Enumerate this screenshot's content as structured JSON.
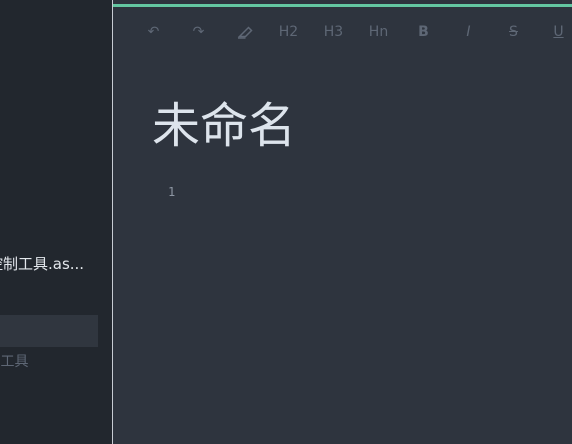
{
  "sidebar": {
    "items": [
      {
        "label": "控制工具.as..."
      },
      {
        "label": ""
      },
      {
        "label": "工具"
      }
    ]
  },
  "toolbar": {
    "buttons": [
      {
        "label": "↶",
        "icon": "undo-icon"
      },
      {
        "label": "↷",
        "icon": "redo-icon"
      },
      {
        "label": "",
        "icon": "eraser-icon"
      },
      {
        "label": "H2",
        "icon": "heading-2-icon"
      },
      {
        "label": "H3",
        "icon": "heading-3-icon"
      },
      {
        "label": "Hn",
        "icon": "heading-n-icon"
      },
      {
        "label": "B",
        "icon": "bold-icon"
      },
      {
        "label": "I",
        "icon": "italic-icon"
      },
      {
        "label": "S",
        "icon": "strikethrough-icon"
      },
      {
        "label": "U",
        "icon": "underline-icon"
      }
    ]
  },
  "editor": {
    "title": "未命名",
    "line_number": "1"
  },
  "colors": {
    "accent": "#64c7a2",
    "editor_bg": "#2e343e",
    "sidebar_bg": "#22272e"
  }
}
